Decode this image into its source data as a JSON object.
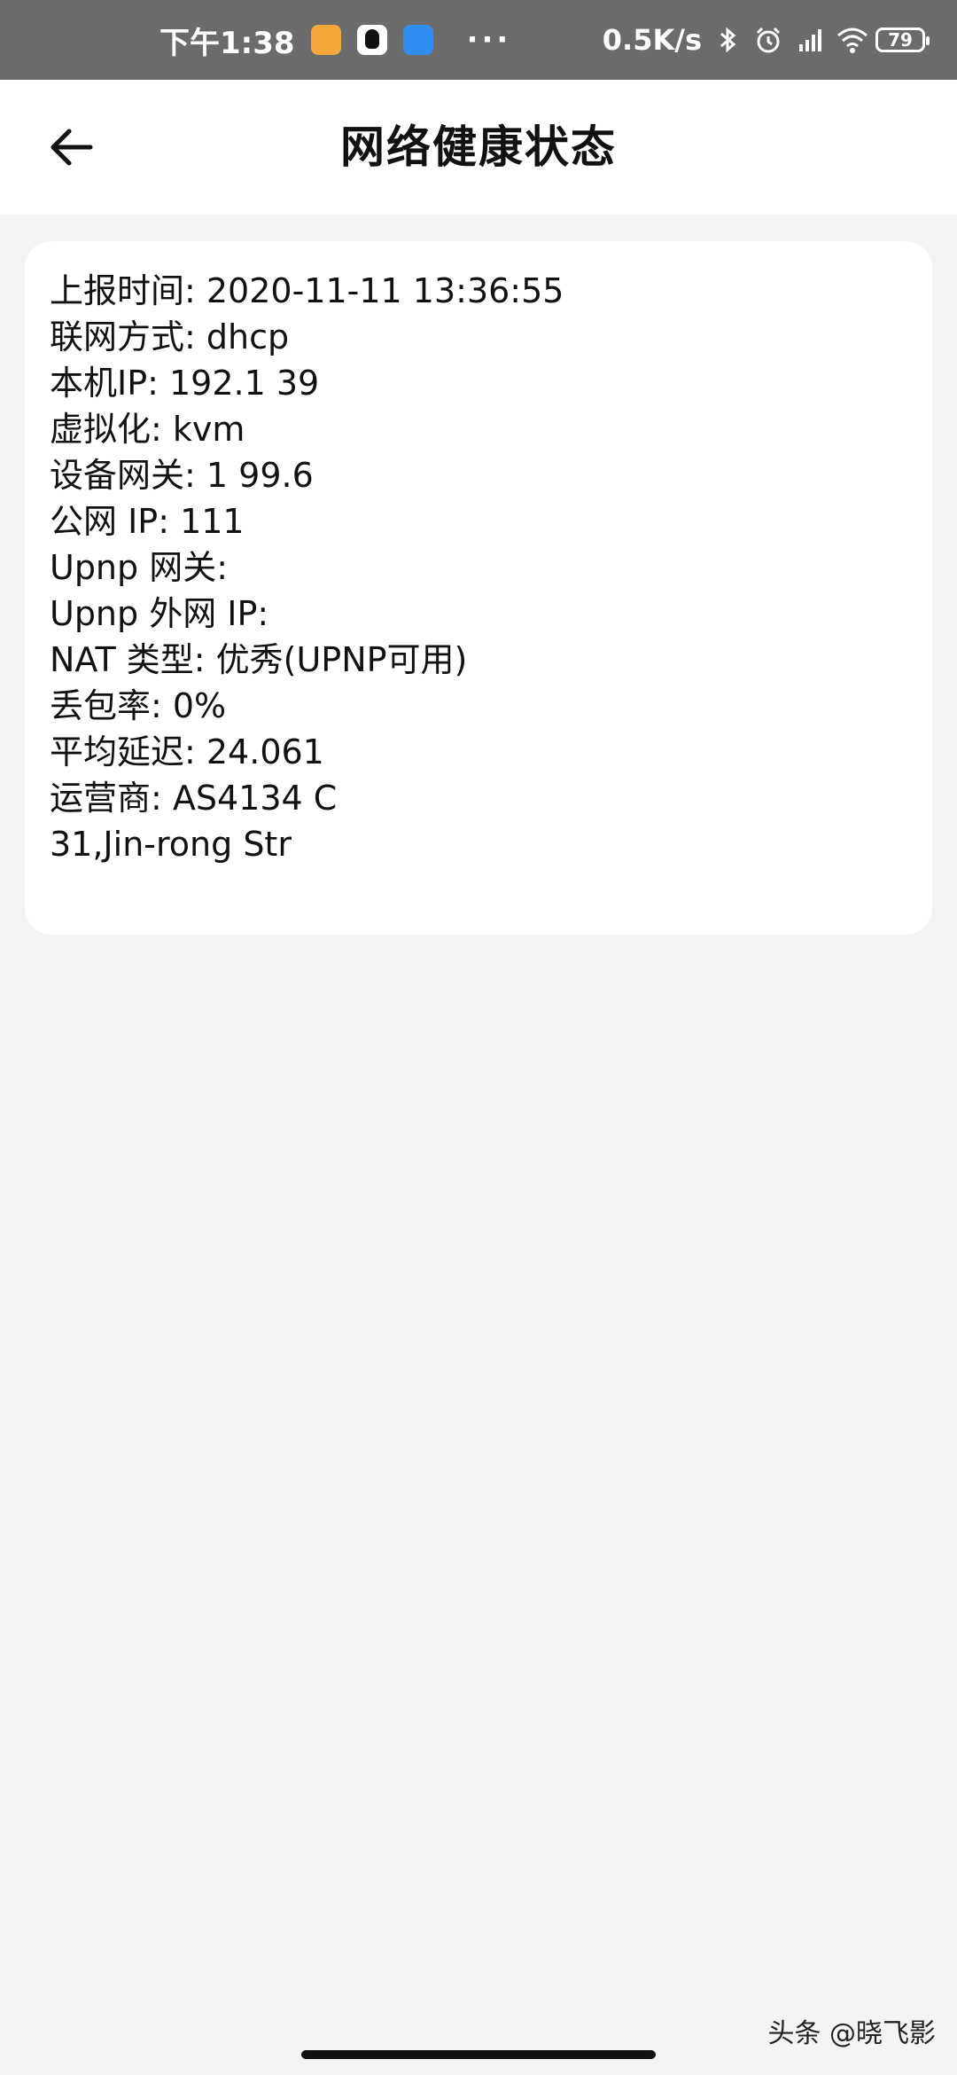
{
  "status_bar": {
    "time": "下午1:38",
    "dots": "···",
    "net_speed": "0.5K/s",
    "battery": "79",
    "icons": [
      "notes-app-icon",
      "qq-icon",
      "feishu-icon",
      "bluetooth-icon",
      "alarm-icon",
      "hd-signal-icon",
      "wifi-icon",
      "battery-icon"
    ]
  },
  "app_bar": {
    "title": "网络健康状态",
    "back_icon": "arrow-left-icon"
  },
  "info": {
    "lines": [
      "上报时间: 2020-11-11 13:36:55",
      "联网方式: dhcp",
      "本机IP: 192.1 39",
      "虚拟化: kvm",
      "设备网关: 1 99.6",
      "公网 IP: 111",
      "Upnp 网关:",
      "Upnp 外网 IP:",
      "NAT 类型: 优秀(UPNP可用)",
      "丢包率: 0%",
      "平均延迟: 24.061",
      "运营商: AS4134 C",
      "31,Jin-rong Str"
    ]
  },
  "watermark": "头条 @晓飞影",
  "colors": {
    "status_bar_bg": "#6b6b6b",
    "page_bg": "#f4f4f4",
    "card_bg": "#ffffff"
  }
}
